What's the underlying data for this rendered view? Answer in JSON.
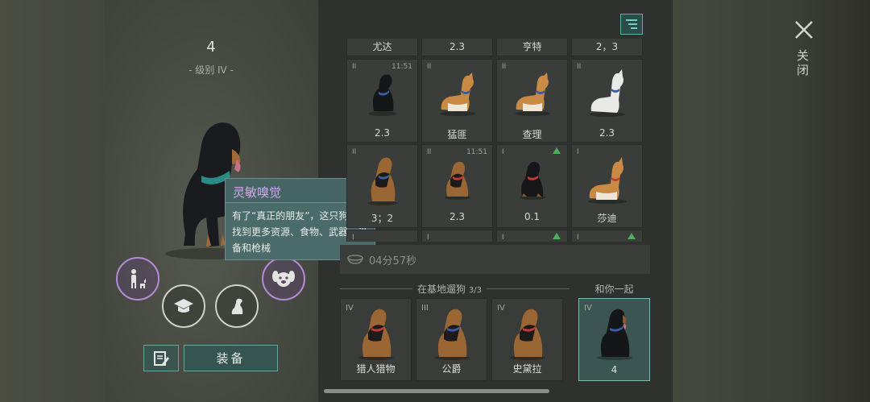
{
  "dog": {
    "level_number": "4",
    "level_label": "- 级别 IV -"
  },
  "tooltip": {
    "title": "灵敏嗅觉",
    "body": "有了“真正的朋友”，这只狗狗会找到更多资源、食物、武器、设备和枪械"
  },
  "actions": {
    "equip_label": "装备",
    "notes_icon": "notes-icon",
    "buttons": [
      "walk-icon",
      "training-icon",
      "sit-dog-icon",
      "dog-face-icon"
    ]
  },
  "grid": {
    "top_row": [
      "尤达",
      "2.3",
      "亨特",
      "2，3"
    ],
    "row1": [
      {
        "tier": "II",
        "timer": "11:51",
        "name": "2.3",
        "coat": "black"
      },
      {
        "tier": "II",
        "timer": "",
        "name": "猛匪",
        "coat": "shiba"
      },
      {
        "tier": "II",
        "timer": "",
        "name": "查理",
        "coat": "shiba"
      },
      {
        "tier": "II",
        "timer": "",
        "name": "2.3",
        "coat": "white"
      }
    ],
    "row2": [
      {
        "tier": "II",
        "timer": "",
        "name": "3；2",
        "coat": "shepherd",
        "arrow": false
      },
      {
        "tier": "II",
        "timer": "11:51",
        "name": "2.3",
        "coat": "shepherd",
        "arrow": false
      },
      {
        "tier": "I",
        "timer": "",
        "name": "0.1",
        "coat": "black",
        "arrow": true
      },
      {
        "tier": "I",
        "timer": "",
        "name": "莎迪",
        "coat": "shiba",
        "arrow": false
      }
    ],
    "row3_tiers": [
      "I",
      "I",
      "I",
      "I"
    ]
  },
  "timer_row": {
    "text": "04分57秒"
  },
  "base": {
    "label": "在基地遛狗",
    "count": "3/3",
    "slots": [
      {
        "tier": "IV",
        "name": "猎人猎物"
      },
      {
        "tier": "III",
        "name": "公爵"
      },
      {
        "tier": "IV",
        "name": "史黛拉"
      }
    ]
  },
  "with_you": {
    "label": "和你一起",
    "tier": "IV",
    "name": "4"
  },
  "close": {
    "label": "关闭"
  },
  "colors": {
    "accent": "#7dbab1",
    "tooltip_title": "#d3a7ec",
    "upgrade_arrow": "#4fae5c"
  }
}
